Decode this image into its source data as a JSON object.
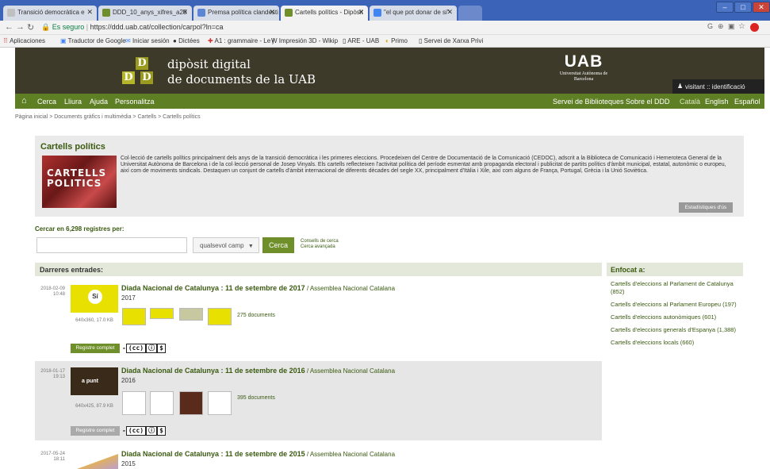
{
  "browser": {
    "tabs": [
      {
        "label": "Transició democràtica e",
        "color": "#c0c0c0"
      },
      {
        "label": "DDD_10_anys_xifres_a20",
        "color": "#6f8f2a"
      },
      {
        "label": "Premsa política clandesti",
        "color": "#5b86d6"
      },
      {
        "label": "Cartells polítics - Dipòsit",
        "color": "#6f8f2a"
      },
      {
        "label": "\"el que pot donar de si\"",
        "color": "#4285f4"
      }
    ],
    "url_secure": "Es seguro",
    "url": "https://ddd.uab.cat/collection/carpol?ln=ca",
    "bookmarks": [
      "Aplicaciones",
      "Traductor de Google",
      "Iniciar sesión",
      "Dictées",
      "A1 : grammaire - Le j",
      "Impresión 3D - Wikip",
      "ARE - UAB",
      "Primo",
      "Servei de Xarxa Privi"
    ]
  },
  "header": {
    "title_line1": "dipòsit digital",
    "title_line2": "de documents de la UAB",
    "logo_letters": [
      "D",
      "D",
      "D"
    ],
    "uab_logo": "UAB",
    "uab_name": "Universitat Autònoma de Barcelona",
    "visitant": "visitant :: identificació"
  },
  "menu": {
    "left": [
      "Cerca",
      "Lliura",
      "Ajuda",
      "Personalitza"
    ],
    "right": [
      "Servei de Biblioteques",
      "Sobre el DDD"
    ],
    "languages": [
      "Català",
      "English",
      "Español"
    ]
  },
  "breadcrumb": "Pàgina inicial > Documents gràfics i multimèdia > Cartells > Cartells polítics",
  "collection": {
    "title": "Cartells polítics",
    "image_text": "CARTELLS POLITICS",
    "description": "Col·lecció de cartells polítics principalment dels anys de la transició democràtica i les primeres eleccions. Procedeixen del Centre de Documentació de la Comunicació (CEDOC), adscrit a la Biblioteca de Comunicació i Hemeroteca General de la Universitat Autònoma de Barcelona i de la col·lecció personal de Josep Vinyals. Els cartells reflecteixen l'activitat política del període esmentat amb propaganda electoral i publicitat de partits polítics d'àmbit municipal, estatal, autonòmic o europeu, així com de moviments sindicals. Destaquen un conjunt de cartells d'àmbit internacional de diferents dècades del segle XX, principalment d'Itàlia i Xile, així com alguns de França, Portugal, Grècia i la Unió Soviètica.",
    "stats_button": "Estadístiques d'ús"
  },
  "search": {
    "label": "Cercar en 6,298 registres per:",
    "select": "qualsevol camp",
    "button": "Cerca",
    "link1": "Consells de cerca",
    "link2": "Cerca avançada"
  },
  "records": {
    "header": "Darreres entrades:",
    "items": [
      {
        "date": "2018-02-09",
        "time": "10:48",
        "title": "Diada Nacional de Catalunya : 11 de setembre de 2017",
        "author": "Assemblea Nacional Catalana",
        "year": "2017",
        "size": "640x360, 17.0 KB",
        "docs": "275 documents",
        "button": "Registre complet",
        "thumb_text": "Sí",
        "thumb_color": "#e8e000"
      },
      {
        "date": "2018-01-17",
        "time": "19:13",
        "title": "Diada Nacional de Catalunya : 11 de setembre de 2016",
        "author": "Assemblea Nacional Catalana",
        "year": "2016",
        "size": "640x425, 87.9 KB",
        "docs": "395 documents",
        "button": "Registre complet",
        "thumb_text": "a punt",
        "thumb_color": "#3a2a1a"
      },
      {
        "date": "2017-05-24",
        "time": "18:11",
        "title": "Diada Nacional de Catalunya : 11 de setembre de 2015",
        "author": "Assemblea Nacional Catalana",
        "year": "2015",
        "thumb_color": "#e0b060"
      }
    ],
    "cc_label": "(cc)"
  },
  "focus": {
    "header": "Enfocat a:",
    "items": [
      "Cartells d'eleccions al Parlament de Catalunya (852)",
      "Cartells d'eleccions al Parlament Europeu (197)",
      "Cartells d'eleccions autonòmiques (601)",
      "Cartells d'eleccions generals d'Espanya (1,388)",
      "Cartells d'eleccions locals (660)"
    ]
  },
  "colors": {
    "menu_green": "#5f7f24",
    "link_green": "#3a5a10",
    "banner_dark": "#3d3a2a",
    "browser_blue": "#3b63b8"
  }
}
